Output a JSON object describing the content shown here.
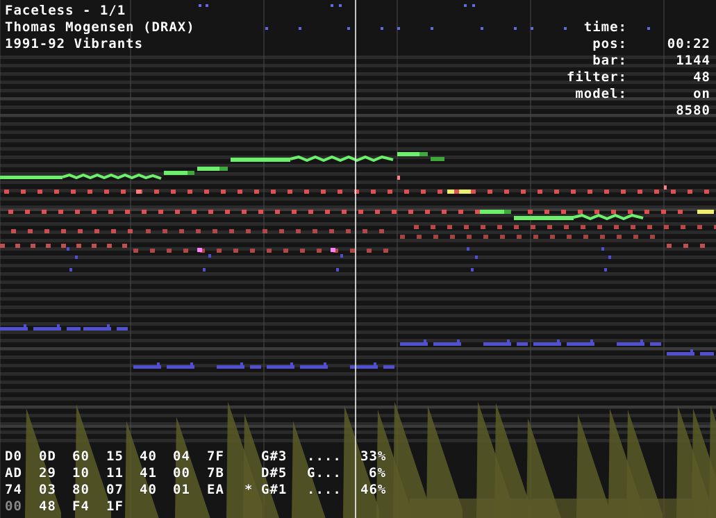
{
  "song": {
    "title": "Faceless - 1/1",
    "author": "Thomas Mogensen (DRAX)",
    "released": "1991-92 Vibrants"
  },
  "info": [
    {
      "label": "time:",
      "value": "00:22"
    },
    {
      "label": "pos:",
      "value": "1144"
    },
    {
      "label": "bar:",
      "value": "48"
    },
    {
      "label": "filter:",
      "value": "on"
    },
    {
      "label": "model:",
      "value": "8580"
    }
  ],
  "registers": [
    {
      "bytes": [
        "D0",
        "0D",
        "60",
        "15",
        "40",
        "04",
        "7F"
      ],
      "marker": "",
      "note": "G#3",
      "flags": "....",
      "level": "33%"
    },
    {
      "bytes": [
        "AD",
        "29",
        "10",
        "11",
        "41",
        "00",
        "7B"
      ],
      "marker": "",
      "note": "D#5",
      "flags": "G...",
      "level": "6%"
    },
    {
      "bytes": [
        "74",
        "03",
        "80",
        "07",
        "40",
        "01",
        "EA"
      ],
      "marker": "*",
      "note": "G#1",
      "flags": "....",
      "level": "46%"
    }
  ],
  "filter_regs": [
    "00",
    "48",
    "F4",
    "1F"
  ],
  "colors": {
    "background": "#151515",
    "row_stripe": "#2a2a2a",
    "voice_lead": "#6cf06c",
    "voice_lead_dark": "#3ea83e",
    "voice_mid": "#e05050",
    "voice_bass": "#5050d0",
    "voice_bass_dark": "#4a4ab8",
    "highlight": "#f0f070",
    "playhead": "#ffffff",
    "bar_line": "#4a4a4a",
    "envelope": "#5a5a28"
  }
}
